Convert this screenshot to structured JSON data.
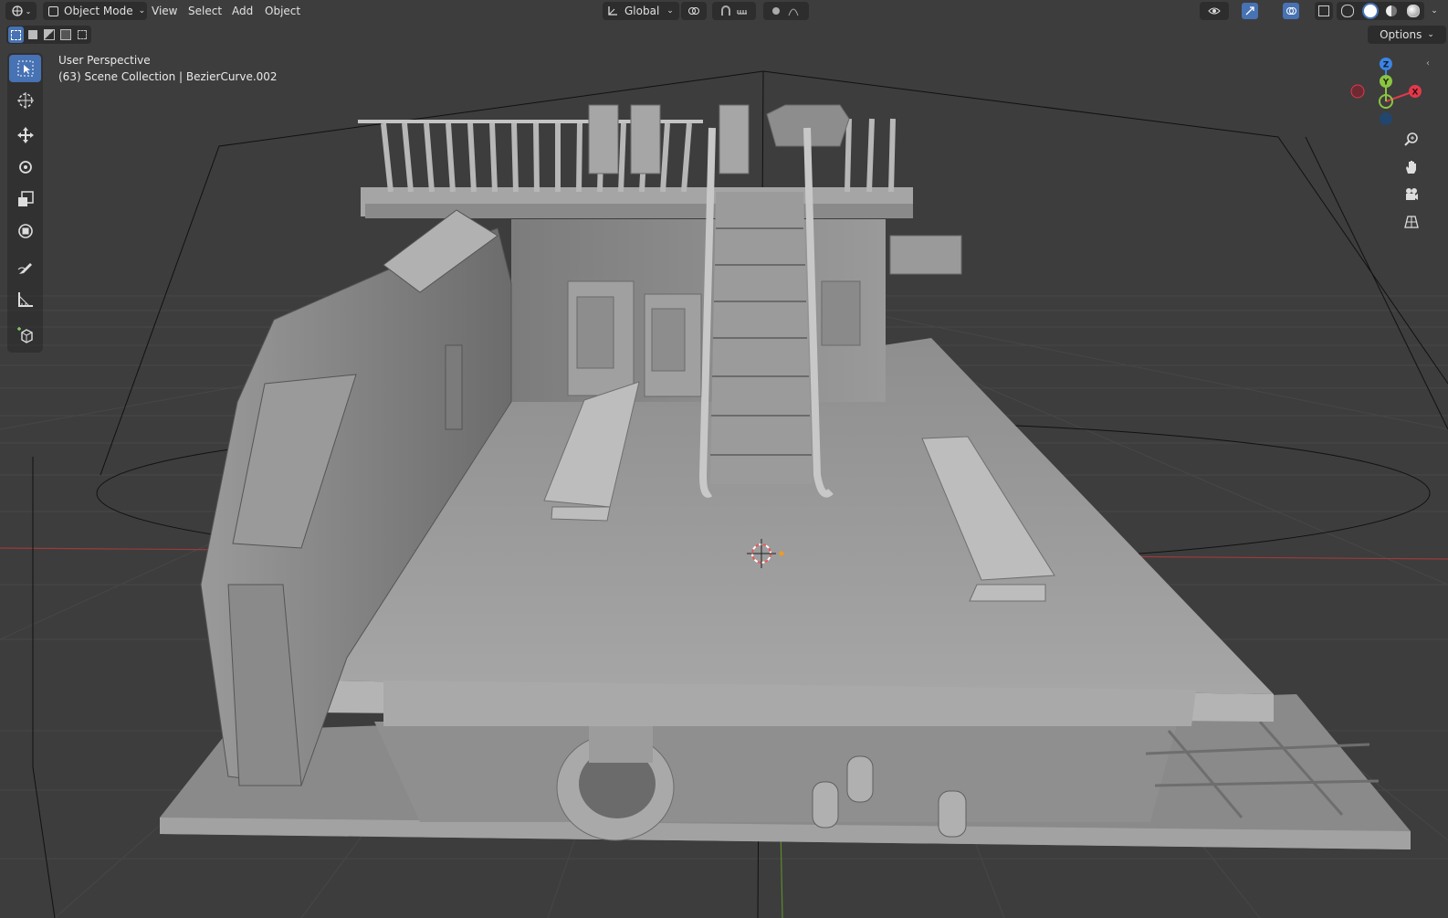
{
  "header": {
    "mode": "Object Mode",
    "menus": [
      "View",
      "Select",
      "Add",
      "Object"
    ],
    "transform_orientation": "Global",
    "options_label": "Options"
  },
  "overlay": {
    "view_name": "User Perspective",
    "collection_info": "(63) Scene Collection | BezierCurve.002"
  },
  "gizmo": {
    "axes": [
      "Z",
      "Y",
      "X"
    ],
    "colors": {
      "x": "#e2394a",
      "y": "#8bc442",
      "z": "#3c84e2"
    }
  },
  "toolbar": {
    "tools": [
      "select-box",
      "cursor",
      "move",
      "rotate",
      "scale",
      "transform",
      "annotate",
      "measure",
      "add-cube"
    ]
  },
  "nav_icons": [
    "zoom-icon",
    "hand-pan-icon",
    "camera-icon",
    "perspective-grid-icon"
  ],
  "theme": {
    "accent": "#4772b3",
    "viewport_bg": "#3d3d3d",
    "x_axis_line": "#9c3b3b",
    "y_axis_line": "#5d8a2b"
  }
}
